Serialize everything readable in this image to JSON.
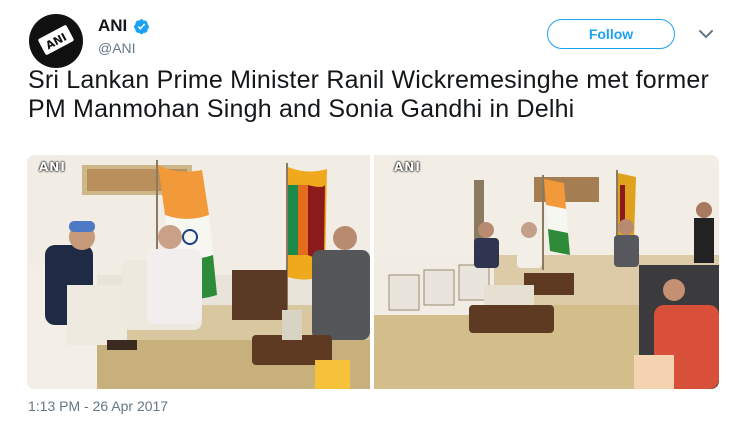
{
  "account": {
    "display_name": "ANI",
    "handle": "@ANI",
    "avatar_text": "ANI",
    "verified": true
  },
  "actions": {
    "follow_label": "Follow"
  },
  "tweet": {
    "text": "Sri Lankan Prime Minister Ranil Wickremesinghe met former PM Manmohan Singh and Sonia Gandhi in Delhi",
    "timestamp": "1:13 PM - 26 Apr 2017"
  },
  "media": {
    "photos": [
      {
        "watermark": "ANI"
      },
      {
        "watermark": "ANI"
      }
    ]
  },
  "colors": {
    "accent": "#1da1f2",
    "text": "#14171a",
    "muted": "#657786"
  },
  "icons": {
    "verified": "verified-badge-icon",
    "menu": "chevron-down-icon"
  }
}
